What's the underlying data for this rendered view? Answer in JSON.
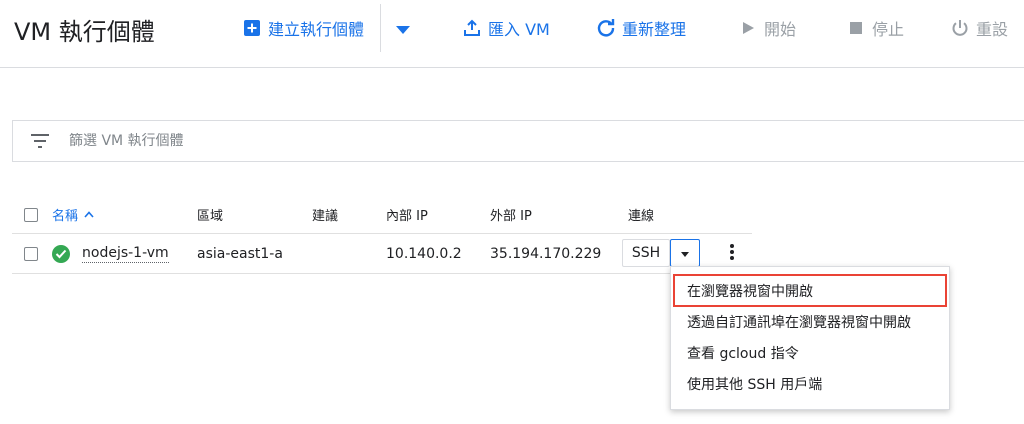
{
  "header": {
    "title": "VM 執行個體",
    "create_label": "建立執行個體",
    "import_label": "匯入 VM",
    "refresh_label": "重新整理",
    "start_label": "開始",
    "stop_label": "停止",
    "reset_label": "重設"
  },
  "filter": {
    "placeholder": "篩選 VM 執行個體"
  },
  "table": {
    "columns": {
      "name": "名稱",
      "zone": "區域",
      "recommendation": "建議",
      "internal_ip": "內部 IP",
      "external_ip": "外部 IP",
      "connect": "連線"
    },
    "rows": [
      {
        "name": "nodejs-1-vm",
        "zone": "asia-east1-a",
        "recommendation": "",
        "internal_ip": "10.140.0.2",
        "external_ip": "35.194.170.229",
        "connect_label": "SSH",
        "status": "running"
      }
    ]
  },
  "ssh_menu": {
    "items": [
      "在瀏覽器視窗中開啟",
      "透過自訂通訊埠在瀏覽器視窗中開啟",
      "查看 gcloud 指令",
      "使用其他 SSH 用戶端"
    ],
    "highlighted_index": 0
  },
  "icons": {
    "create": "add-box-icon",
    "dropdown": "caret-down-icon",
    "import": "upload-icon",
    "refresh": "refresh-icon",
    "start": "play-icon",
    "stop": "stop-icon",
    "reset": "power-icon",
    "filter": "filter-list-icon",
    "sort": "sort-ascending-icon",
    "status": "check-circle-icon",
    "more": "more-vert-icon"
  },
  "colors": {
    "accent": "#1a73e8",
    "disabled": "#9aa0a6",
    "status_ok": "#34a853",
    "highlight": "#ea4335"
  }
}
